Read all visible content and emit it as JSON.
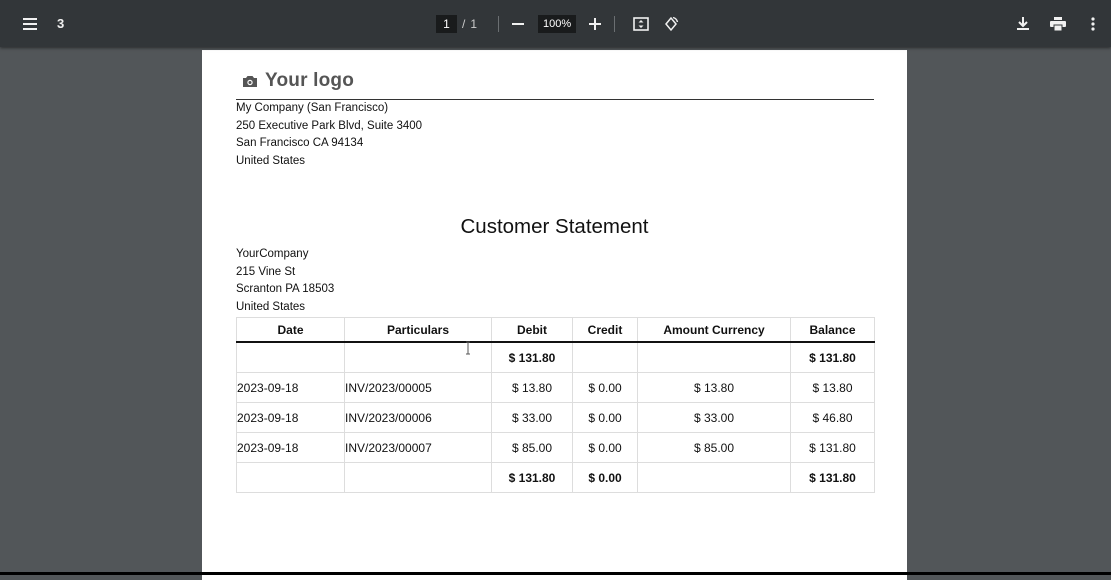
{
  "toolbar": {
    "title": "3",
    "page_current": "1",
    "page_separator": "/",
    "page_total": "1",
    "zoom": "100%",
    "icons": [
      "menu-icon",
      "zoom-out-icon",
      "zoom-in-icon",
      "fit-page-icon",
      "rotate-icon",
      "download-icon",
      "print-icon",
      "more-icon"
    ]
  },
  "document": {
    "logo_text": "Your logo",
    "company_address": [
      "My Company (San Francisco)",
      "250 Executive Park Blvd, Suite 3400",
      "San Francisco CA 94134",
      "United States"
    ],
    "heading": "Customer Statement",
    "customer_address": [
      "YourCompany",
      "215 Vine St",
      "Scranton PA 18503",
      "United States"
    ],
    "table": {
      "headers": [
        "Date",
        "Particulars",
        "Debit",
        "Credit",
        "Amount Currency",
        "Balance"
      ],
      "opening_row": [
        "",
        "",
        "$ 131.80",
        "",
        "",
        "$ 131.80"
      ],
      "rows": [
        [
          "2023-09-18",
          "INV/2023/00005",
          "$ 13.80",
          "$ 0.00",
          "$ 13.80",
          "$ 13.80"
        ],
        [
          "2023-09-18",
          "INV/2023/00006",
          "$ 33.00",
          "$ 0.00",
          "$ 33.00",
          "$ 46.80"
        ],
        [
          "2023-09-18",
          "INV/2023/00007",
          "$ 85.00",
          "$ 0.00",
          "$ 85.00",
          "$ 131.80"
        ]
      ],
      "total_row": [
        "",
        "",
        "$ 131.80",
        "$ 0.00",
        "",
        "$ 131.80"
      ]
    }
  },
  "colors": {
    "toolbar_bg": "#323639",
    "viewer_bg": "#525659",
    "page_bg": "#ffffff"
  }
}
